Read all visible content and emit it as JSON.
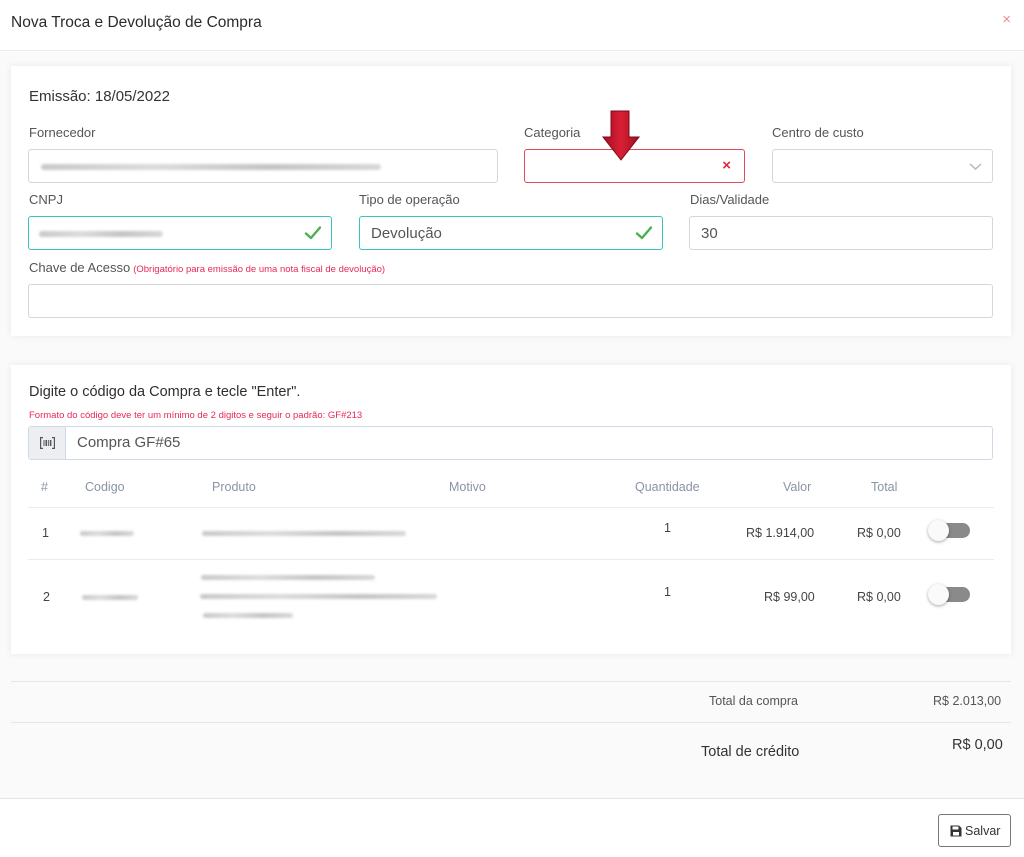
{
  "modal": {
    "title": "Nova Troca e Devolução de Compra",
    "close_icon": "×"
  },
  "form": {
    "emissao": "Emissão: 18/05/2022",
    "fornecedor": {
      "label": "Fornecedor",
      "value": ""
    },
    "categoria": {
      "label": "Categoria",
      "value": "",
      "status": "invalid",
      "status_icon": "×"
    },
    "centro_custo": {
      "label": "Centro de custo",
      "value": ""
    },
    "cnpj": {
      "label": "CNPJ",
      "value": "",
      "status": "valid"
    },
    "tipo_operacao": {
      "label": "Tipo de operação",
      "value": "Devolução",
      "status": "valid"
    },
    "dias_validade": {
      "label": "Dias/Validade",
      "value": "30"
    },
    "chave_acesso": {
      "label": "Chave de Acesso",
      "hint": "(Obrigatório para emissão de uma nota fiscal de devolução)",
      "value": ""
    }
  },
  "purchase": {
    "instruction": "Digite o código da Compra e tecle \"Enter\".",
    "format_hint": "Formato do código deve ter um mínimo de 2 digitos e seguir o padrão: GF#213",
    "search_value": "Compra GF#65",
    "search_icon": "barcode-icon",
    "columns": [
      "#",
      "Codigo",
      "Produto",
      "Motivo",
      "Quantidade",
      "Valor",
      "Total"
    ],
    "rows": [
      {
        "index": "1",
        "codigo": "",
        "produto": "",
        "motivo": "",
        "quantidade": "1",
        "valor": "R$ 1.914,00",
        "total": "R$ 0,00",
        "selected": false
      },
      {
        "index": "2",
        "codigo": "",
        "produto": "",
        "motivo": "",
        "quantidade": "1",
        "valor": "R$ 99,00",
        "total": "R$ 0,00",
        "selected": false
      }
    ]
  },
  "summary": {
    "total_compra_label": "Total da compra",
    "total_compra_value": "R$ 2.013,00",
    "total_credito_label": "Total de crédito",
    "total_credito_value": "R$ 0,00"
  },
  "footer": {
    "save_label": "Salvar",
    "save_icon": "floppy-disk-icon"
  },
  "colors": {
    "invalid": "#e8475b",
    "valid": "#37c4c0",
    "check": "#4caf50",
    "arrow": "#c8102e",
    "hint": "#e8285a"
  }
}
